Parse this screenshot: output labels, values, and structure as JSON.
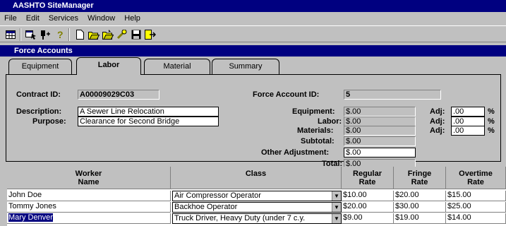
{
  "app": {
    "title": "AASHTO SiteManager"
  },
  "menu": [
    "File",
    "Edit",
    "Services",
    "Window",
    "Help"
  ],
  "toolbar": [
    "grid-icon",
    "explorer-icon",
    "pin-icon",
    "help-icon",
    "new-icon",
    "open-icon",
    "open-multi-icon",
    "tools-icon",
    "save-icon",
    "exit-icon"
  ],
  "window": {
    "title": "Force Accounts"
  },
  "tabs": [
    "Equipment",
    "Labor",
    "Material",
    "Summary"
  ],
  "active_tab": "Labor",
  "form": {
    "contract_id_label": "Contract ID:",
    "contract_id": "A00009029C03",
    "force_account_id_label": "Force Account ID:",
    "force_account_id": "5",
    "description_label": "Description:",
    "description": "A Sewer Line Relocation",
    "purpose_label": "Purpose:",
    "purpose": "Clearance for Second Bridge",
    "equipment_label": "Equipment:",
    "equipment": "$.00",
    "labor_label": "Labor:",
    "labor": "$.00",
    "materials_label": "Materials:",
    "materials": "$.00",
    "subtotal_label": "Subtotal:",
    "subtotal": "$.00",
    "other_adjustment_label": "Other Adjustment:",
    "other_adjustment": "$.00",
    "total_label": "Total:",
    "total": "$.00",
    "adj_label": "Adj:",
    "adj_equipment": ".00",
    "adj_labor": ".00",
    "adj_materials": ".00",
    "percent": "%"
  },
  "grid": {
    "columns": {
      "worker_name": "Worker\nName",
      "class": "Class",
      "regular_rate": "Regular\nRate",
      "fringe_rate": "Fringe\nRate",
      "overtime_rate": "Overtime\nRate"
    },
    "rows": [
      {
        "name": "John Doe",
        "class": "Air Compressor Operator",
        "regular": "$10.00",
        "fringe": "$20.00",
        "overtime": "$15.00"
      },
      {
        "name": "Tommy Jones",
        "class": "Backhoe Operator",
        "regular": "$20.00",
        "fringe": "$30.00",
        "overtime": "$25.00"
      },
      {
        "name": "Mary Denver",
        "class": "Truck Driver, Heavy Duty (under 7 c.y.",
        "regular": "$9.00",
        "fringe": "$19.00",
        "overtime": "$14.00"
      }
    ]
  }
}
